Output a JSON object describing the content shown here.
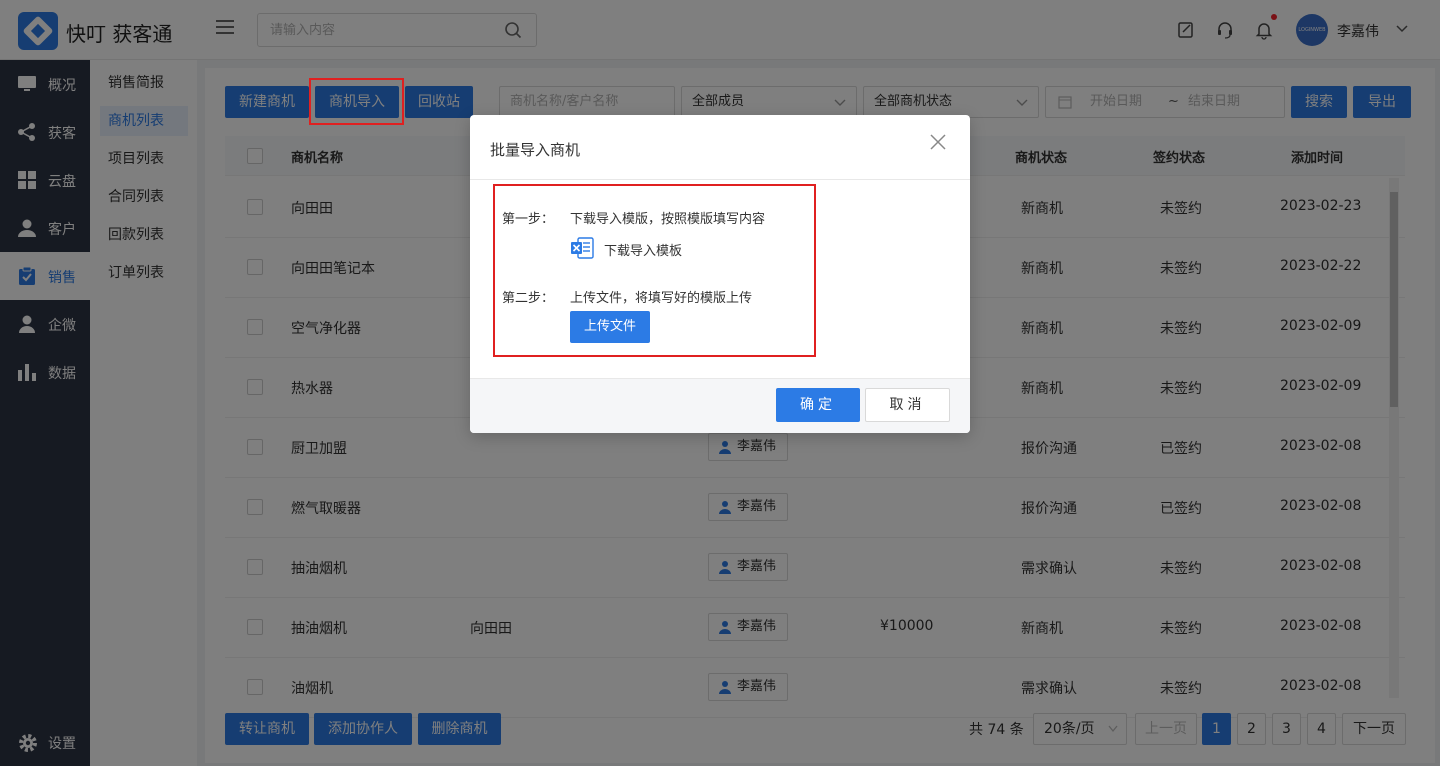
{
  "app": {
    "title": "快叮 获客通"
  },
  "header": {
    "search_placeholder": "请输入内容",
    "user_name": "李嘉伟",
    "avatar_text": "LOGINWEB"
  },
  "sidebar": {
    "items": [
      {
        "label": "概况",
        "icon": "monitor-icon"
      },
      {
        "label": "获客",
        "icon": "share-icon"
      },
      {
        "label": "云盘",
        "icon": "grid-icon"
      },
      {
        "label": "客户",
        "icon": "user-icon"
      },
      {
        "label": "销售",
        "icon": "clipboard-check-icon",
        "active": true
      },
      {
        "label": "企微",
        "icon": "person-icon"
      },
      {
        "label": "数据",
        "icon": "bar-chart-icon"
      }
    ],
    "settings_label": "设置"
  },
  "subnav": {
    "items": [
      "销售简报",
      "商机列表",
      "项目列表",
      "合同列表",
      "回款列表",
      "订单列表"
    ],
    "active_index": 1
  },
  "toolbar": {
    "new_label": "新建商机",
    "import_label": "商机导入",
    "recycle_label": "回收站",
    "name_placeholder": "商机名称/客户名称",
    "member_select": "全部成员",
    "status_select": "全部商机状态",
    "start_date": "开始日期",
    "date_sep": "~",
    "end_date": "结束日期",
    "search_label": "搜索",
    "export_label": "导出"
  },
  "table": {
    "headers": {
      "name": "商机名称",
      "status": "商机状态",
      "sign": "签约状态",
      "added": "添加时间"
    },
    "rows": [
      {
        "name": "向田田",
        "customer": "",
        "owner": "",
        "amount": "",
        "status": "新商机",
        "sign": "未签约",
        "date": "2023-02-23"
      },
      {
        "name": "向田田笔记本",
        "customer": "",
        "owner": "",
        "amount": "",
        "status": "新商机",
        "sign": "未签约",
        "date": "2023-02-22"
      },
      {
        "name": "空气净化器",
        "customer": "",
        "owner": "",
        "amount": "",
        "status": "新商机",
        "sign": "未签约",
        "date": "2023-02-09"
      },
      {
        "name": "热水器",
        "customer": "",
        "owner": "",
        "amount": "",
        "status": "新商机",
        "sign": "未签约",
        "date": "2023-02-09"
      },
      {
        "name": "厨卫加盟",
        "customer": "",
        "owner": "李嘉伟",
        "amount": "",
        "status": "报价沟通",
        "sign": "已签约",
        "date": "2023-02-08"
      },
      {
        "name": "燃气取暖器",
        "customer": "",
        "owner": "李嘉伟",
        "amount": "",
        "status": "报价沟通",
        "sign": "已签约",
        "date": "2023-02-08"
      },
      {
        "name": "抽油烟机",
        "customer": "",
        "owner": "李嘉伟",
        "amount": "",
        "status": "需求确认",
        "sign": "未签约",
        "date": "2023-02-08"
      },
      {
        "name": "抽油烟机",
        "customer": "向田田",
        "owner": "李嘉伟",
        "amount": "¥10000",
        "status": "新商机",
        "sign": "未签约",
        "date": "2023-02-08"
      },
      {
        "name": "油烟机",
        "customer": "",
        "owner": "李嘉伟",
        "amount": "",
        "status": "需求确认",
        "sign": "未签约",
        "date": "2023-02-08"
      }
    ]
  },
  "footer": {
    "transfer_label": "转让商机",
    "add_collab_label": "添加协作人",
    "delete_label": "删除商机",
    "total_text": "共 74 条",
    "page_size": "20条/页",
    "prev_label": "上一页",
    "pages": [
      "1",
      "2",
      "3",
      "4"
    ],
    "current_page": "1",
    "next_label": "下一页"
  },
  "modal": {
    "title": "批量导入商机",
    "step1_label": "第一步：",
    "step1_text": "下载导入模版，按照模版填写内容",
    "template_link": "下载导入模板",
    "step2_label": "第二步：",
    "step2_text": "上传文件，将填写好的模版上传",
    "upload_label": "上传文件",
    "ok_label": "确定",
    "cancel_label": "取消"
  },
  "colors": {
    "primary": "#2c7be5",
    "sidebar": "#2d3444",
    "highlight": "#e02020"
  }
}
